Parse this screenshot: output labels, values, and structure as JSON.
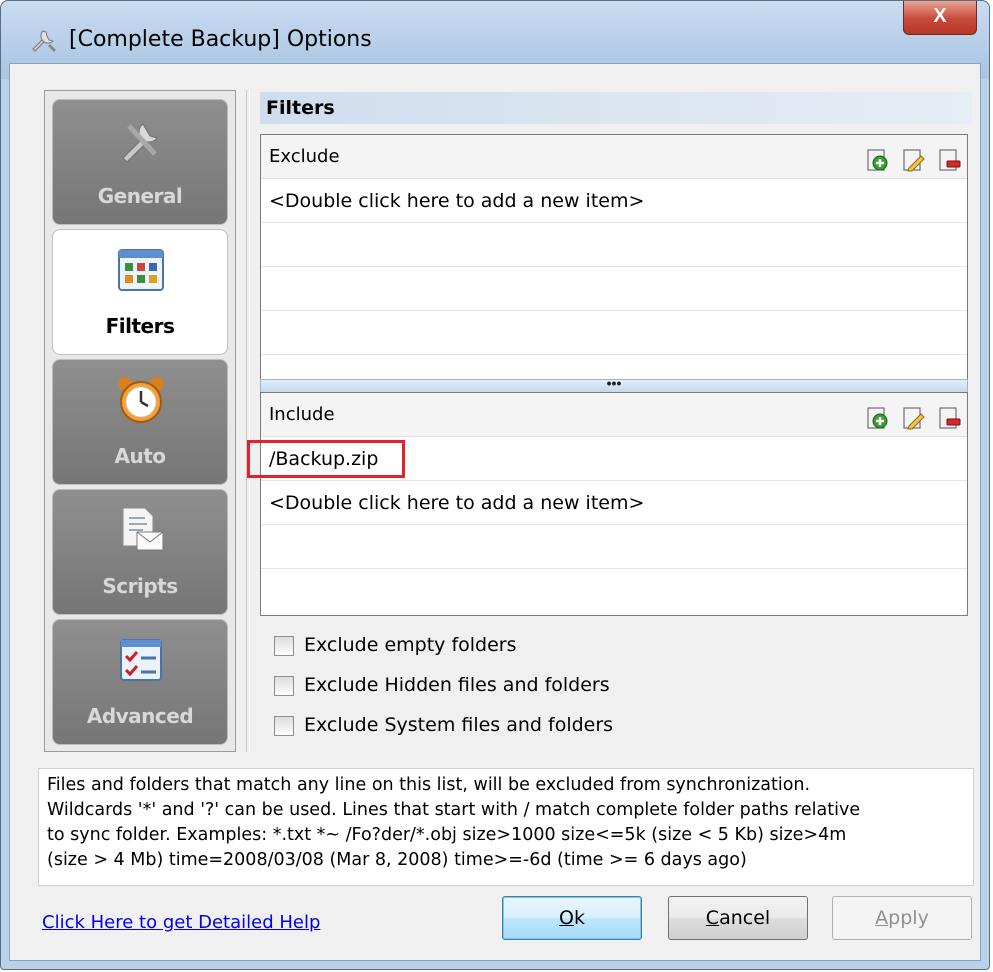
{
  "window": {
    "title": "[Complete Backup] Options",
    "close_label": "X"
  },
  "nav": {
    "items": [
      {
        "label": "General",
        "icon": "tools-icon",
        "active": false
      },
      {
        "label": "Filters",
        "icon": "filters-grid-icon",
        "active": true
      },
      {
        "label": "Auto",
        "icon": "alarm-clock-icon",
        "active": false
      },
      {
        "label": "Scripts",
        "icon": "document-envelope-icon",
        "active": false
      },
      {
        "label": "Advanced",
        "icon": "checklist-icon",
        "active": false
      }
    ]
  },
  "filters": {
    "header": "Filters",
    "exclude": {
      "title": "Exclude",
      "rows": [
        "<Double click here to add a new item>",
        "",
        "",
        ""
      ]
    },
    "splitter_label": "•••",
    "include": {
      "title": "Include",
      "rows": [
        "/Backup.zip",
        "<Double click here to add a new item>",
        "",
        ""
      ]
    },
    "checkboxes": [
      {
        "label": "Exclude empty folders",
        "checked": false
      },
      {
        "label": "Exclude Hidden files and folders",
        "checked": false
      },
      {
        "label": "Exclude System files and folders",
        "checked": false
      }
    ]
  },
  "help": {
    "lines": [
      "Files and folders that match any line on this list, will be excluded from synchronization.",
      "Wildcards '*' and '?' can be used. Lines that start with / match complete folder paths relative",
      "to sync folder. Examples: *.txt *~ /Fo?der/*.obj size>1000 size<=5k (size < 5 Kb) size>4m",
      "(size > 4 Mb) time=2008/03/08 (Mar 8, 2008) time>=-6d (time >= 6 days ago)"
    ],
    "link": "Click Here to get Detailed Help"
  },
  "buttons": {
    "ok": {
      "label": "Ok",
      "mnemonic": "O",
      "rest": "k"
    },
    "cancel": {
      "label": "Cancel",
      "mnemonic": "C",
      "rest": "ancel"
    },
    "apply": {
      "label": "Apply",
      "mnemonic": "A",
      "rest": "pply"
    }
  }
}
